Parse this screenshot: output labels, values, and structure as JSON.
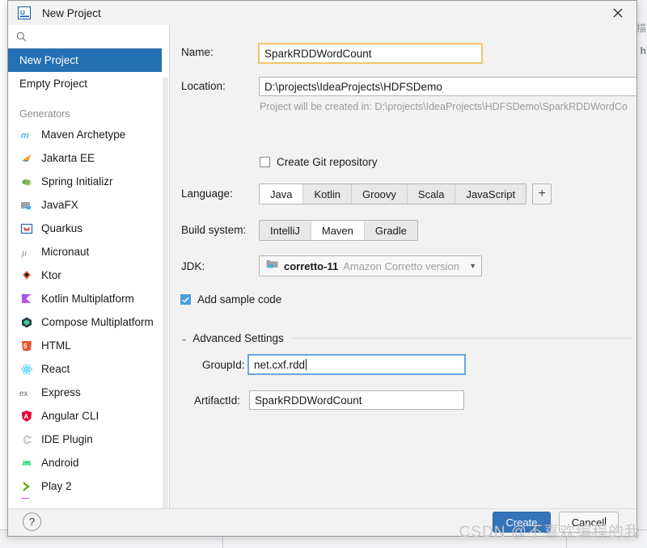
{
  "window": {
    "title": "New Project",
    "app_icon": "intellij-idea-icon",
    "close_icon": "close-icon"
  },
  "sidebar": {
    "search": {
      "value": "",
      "placeholder": "",
      "icon": "search-icon"
    },
    "project_types": [
      {
        "label": "New Project",
        "selected": true
      },
      {
        "label": "Empty Project",
        "selected": false
      }
    ],
    "section_label": "Generators",
    "generators": [
      {
        "label": "Maven Archetype",
        "icon": "maven-icon"
      },
      {
        "label": "Jakarta EE",
        "icon": "jakarta-ee-icon"
      },
      {
        "label": "Spring Initializr",
        "icon": "spring-icon"
      },
      {
        "label": "JavaFX",
        "icon": "javafx-icon"
      },
      {
        "label": "Quarkus",
        "icon": "quarkus-icon"
      },
      {
        "label": "Micronaut",
        "icon": "micronaut-icon"
      },
      {
        "label": "Ktor",
        "icon": "ktor-icon"
      },
      {
        "label": "Kotlin Multiplatform",
        "icon": "kotlin-icon"
      },
      {
        "label": "Compose Multiplatform",
        "icon": "compose-icon"
      },
      {
        "label": "HTML",
        "icon": "html5-icon"
      },
      {
        "label": "React",
        "icon": "react-icon"
      },
      {
        "label": "Express",
        "icon": "express-icon"
      },
      {
        "label": "Angular CLI",
        "icon": "angular-icon"
      },
      {
        "label": "IDE Plugin",
        "icon": "plugin-icon"
      },
      {
        "label": "Android",
        "icon": "android-icon"
      },
      {
        "label": "Play 2",
        "icon": "play2-icon"
      }
    ]
  },
  "form": {
    "name": {
      "label": "Name:",
      "value": "SparkRDDWordCount",
      "state": "warning"
    },
    "location": {
      "label": "Location:",
      "value": "D:\\projects\\IdeaProjects\\HDFSDemo"
    },
    "location_hint": "Project will be created in: D:\\projects\\IdeaProjects\\HDFSDemo\\SparkRDDWordCo",
    "git": {
      "label": "Create Git repository",
      "checked": false
    },
    "language": {
      "label": "Language:",
      "options": [
        "Java",
        "Kotlin",
        "Groovy",
        "Scala",
        "JavaScript"
      ],
      "selected": "Java",
      "add_label": "+"
    },
    "build_system": {
      "label": "Build system:",
      "options": [
        "IntelliJ",
        "Maven",
        "Gradle"
      ],
      "selected": "Maven"
    },
    "jdk": {
      "label": "JDK:",
      "icon": "jdk-folder-icon",
      "value": "corretto-11",
      "description": "Amazon Corretto version",
      "arrow": "▼"
    },
    "sample_code": {
      "label": "Add sample code",
      "checked": true
    },
    "advanced": {
      "chevron": "⌄",
      "title": "Advanced Settings",
      "group_id": {
        "label": "GroupId:",
        "value": "net.cxf.rdd",
        "state": "focused"
      },
      "artifact_id": {
        "label": "ArtifactId:",
        "value": "SparkRDDWordCount"
      }
    }
  },
  "footer": {
    "help_label": "?",
    "create_label": "Create",
    "cancel_label": "Cancel"
  },
  "watermark": "CSDN @不喜欢编程的我",
  "background": {
    "text_1": "描",
    "text_2": "h"
  },
  "colors": {
    "accent": "#2470b3",
    "create_button": "#3574b8",
    "warning_border": "#f5c26b",
    "focus_border": "#6aa3e0",
    "checkbox_checked": "#4a9fe0"
  }
}
